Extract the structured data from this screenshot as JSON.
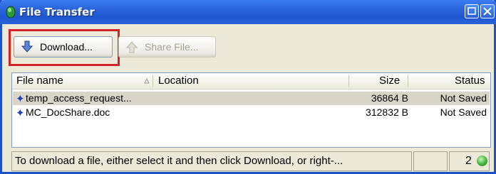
{
  "window": {
    "title": "File Transfer"
  },
  "toolbar": {
    "download_label": "Download...",
    "share_label": "Share File..."
  },
  "list": {
    "columns": [
      "File name",
      "Location",
      "Size",
      "Status"
    ],
    "rows": [
      {
        "name": "temp_access_request...",
        "location": "",
        "size": "36864 B",
        "status": "Not Saved",
        "selected": true
      },
      {
        "name": "MC_DocShare.doc",
        "location": "",
        "size": "312832 B",
        "status": "Not Saved",
        "selected": false
      }
    ]
  },
  "statusbar": {
    "message": "To download a file, either select it and then click Download, or right-...",
    "count": "2"
  },
  "colors": {
    "titlebar": "#2b65dc",
    "highlight": "#d2232a",
    "status_light": "#3fb43a"
  }
}
